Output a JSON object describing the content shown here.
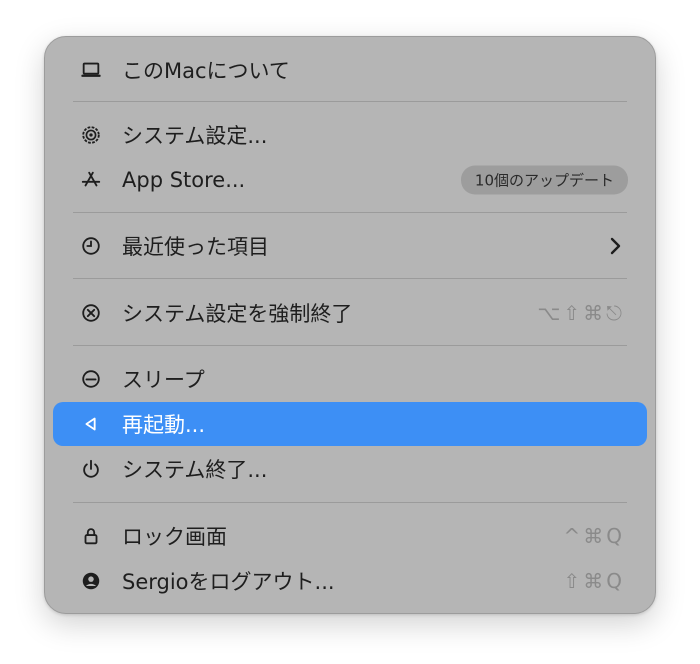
{
  "menu": {
    "items": [
      {
        "label": "このMacについて",
        "icon": "laptop-icon"
      },
      {
        "label": "システム設定...",
        "icon": "gear-icon"
      },
      {
        "label": "App Store...",
        "icon": "app-store-icon",
        "badge": "10個のアップデート"
      },
      {
        "label": "最近使った項目",
        "icon": "clock-icon",
        "submenu": true
      },
      {
        "label": "システム設定を強制終了",
        "icon": "force-quit-icon",
        "shortcut": "⌥⇧⌘⎋"
      },
      {
        "label": "スリープ",
        "icon": "sleep-icon"
      },
      {
        "label": "再起動...",
        "icon": "restart-icon",
        "highlighted": true
      },
      {
        "label": "システム終了...",
        "icon": "power-icon"
      },
      {
        "label": "ロック画面",
        "icon": "lock-icon",
        "shortcut": "^⌘Q"
      },
      {
        "label": "Sergioをログアウト...",
        "icon": "user-icon",
        "shortcut": "⇧⌘Q"
      }
    ]
  },
  "colors": {
    "menu_background": "#b5b5b5",
    "highlight": "#3d8ff5",
    "text": "#1e1e1e",
    "shortcut_text": "#8a8a8a",
    "badge_background": "#9d9d9d"
  }
}
